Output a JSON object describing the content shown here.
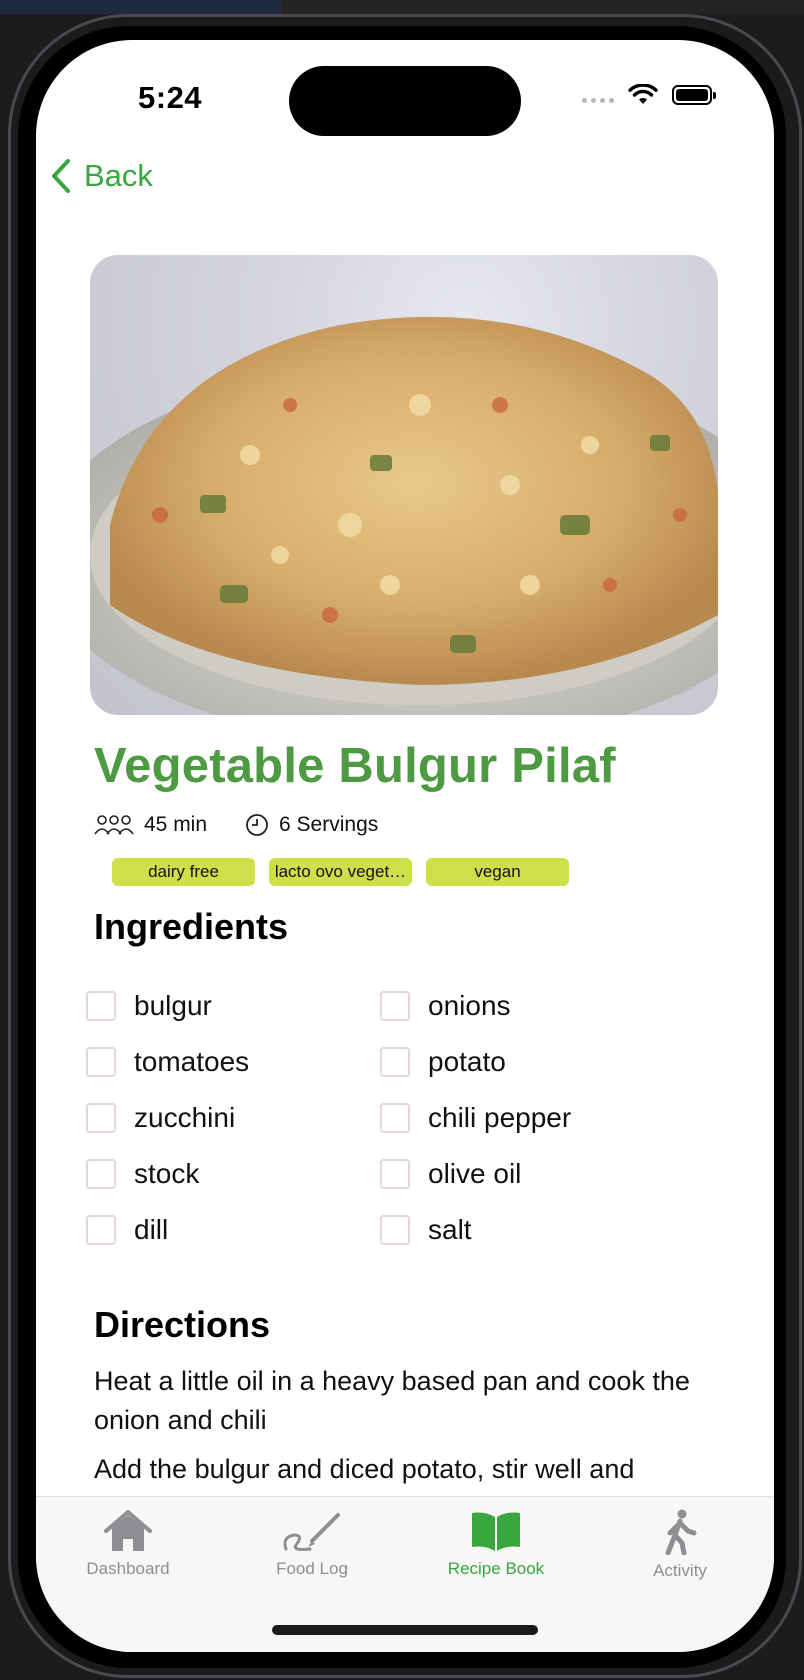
{
  "status": {
    "time": "5:24"
  },
  "nav": {
    "back_label": "Back"
  },
  "recipe": {
    "title": "Vegetable Bulgur Pilaf",
    "time": "45 min",
    "servings": "6 Servings",
    "tags": [
      "dairy free",
      "lacto ovo veget…",
      "vegan"
    ]
  },
  "ingredients": {
    "heading": "Ingredients",
    "items": [
      "bulgur",
      "onions",
      "tomatoes",
      "potato",
      "zucchini",
      "chili pepper",
      "stock",
      "olive oil",
      "dill",
      "salt"
    ]
  },
  "directions": {
    "heading": "Directions",
    "steps": [
      "Heat a little oil in a heavy based pan and cook the onion and chili",
      "Add the bulgur and diced potato, stir well and"
    ]
  },
  "tabbar": {
    "tabs": [
      {
        "label": "Dashboard",
        "icon": "house-icon"
      },
      {
        "label": "Food Log",
        "icon": "pencil-scribble-icon"
      },
      {
        "label": "Recipe Book",
        "icon": "open-book-icon"
      },
      {
        "label": "Activity",
        "icon": "walking-figure-icon"
      }
    ],
    "active": "Recipe Book"
  },
  "colors": {
    "accent": "#3aa63f",
    "title_green": "#4e9a43",
    "tag_bg": "#cde04a",
    "inactive_tab": "#8e8e93"
  }
}
